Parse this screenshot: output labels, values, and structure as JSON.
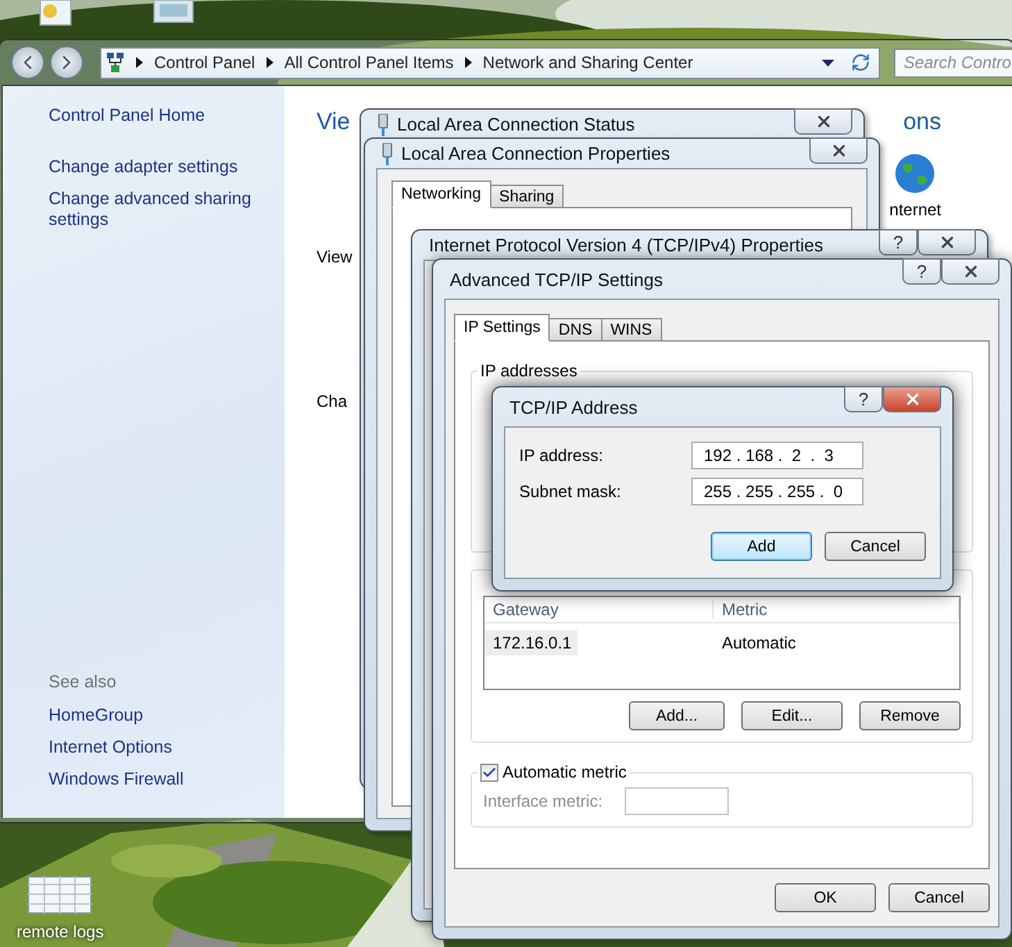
{
  "desktop_icons": [
    {
      "label": "remote logs"
    }
  ],
  "explorer": {
    "breadcrumb": [
      "Control Panel",
      "All Control Panel Items",
      "Network and Sharing Center"
    ],
    "search": {
      "placeholder": "Search Contro"
    },
    "sidebar": {
      "links": [
        "Control Panel Home",
        "Change adapter settings",
        "Change advanced sharing settings"
      ],
      "see_also_heading": "See also",
      "see_also": [
        "HomeGroup",
        "Internet Options",
        "Windows Firewall"
      ]
    },
    "content": {
      "heading_start": "Vie",
      "heading_end": "ons",
      "line_1": "View",
      "line_2": "Cha",
      "map_label": "nternet"
    }
  },
  "windows": [
    {
      "kind": "status",
      "title": "Local Area Connection Status"
    },
    {
      "kind": "properties",
      "title": "Local Area Connection Properties",
      "tabs": [
        {
          "label": "Networking",
          "selected": true
        },
        {
          "label": "Sharing",
          "selected": false
        }
      ]
    },
    {
      "kind": "ipv4",
      "title": "Internet Protocol Version 4 (TCP/IPv4) Properties",
      "help_button": "?"
    }
  ],
  "advanced": {
    "title": "Advanced TCP/IP Settings",
    "help_button": "?",
    "tabs": [
      {
        "label": "IP Settings",
        "selected": true
      },
      {
        "label": "DNS",
        "selected": false
      },
      {
        "label": "WINS",
        "selected": false
      }
    ],
    "ip_group_title": "IP addresses",
    "gateways": {
      "columns": [
        "Gateway",
        "Metric"
      ],
      "rows": [
        {
          "cells": [
            "172.16.0.1",
            "Automatic"
          ],
          "selected": true
        }
      ]
    },
    "gateway_buttons": [
      "Add...",
      "Edit...",
      "Remove"
    ],
    "automatic_metric": {
      "label": "Automatic metric",
      "checked": true
    },
    "interface_metric": {
      "label": "Interface metric:",
      "disabled": true
    },
    "buttons": [
      "OK",
      "Cancel"
    ]
  },
  "dialog": {
    "title": "TCP/IP Address",
    "help_button": "?",
    "fields": [
      {
        "label": "IP address:",
        "value": "192 . 168 .  2  .  3"
      },
      {
        "label": "Subnet mask:",
        "value": "255 . 255 . 255 .  0"
      }
    ],
    "buttons": [
      {
        "label": "Add",
        "default": true
      },
      {
        "label": "Cancel",
        "default": false
      }
    ]
  }
}
